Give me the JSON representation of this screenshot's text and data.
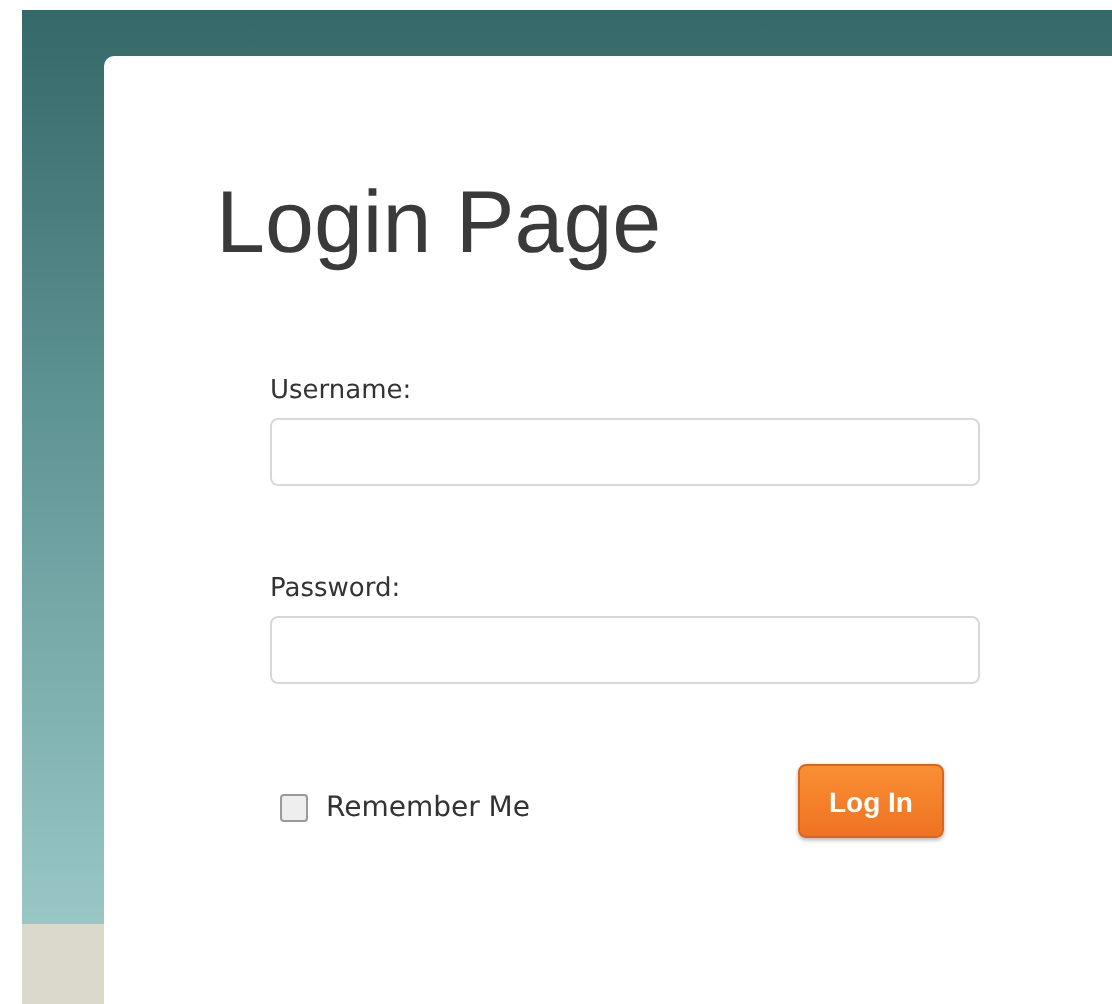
{
  "title": "Login Page",
  "fields": [
    {
      "label": "Username:"
    },
    {
      "label": "Password:"
    }
  ],
  "remember": {
    "label": "Remember Me",
    "checked": false
  },
  "submit": {
    "label": "Log In"
  }
}
